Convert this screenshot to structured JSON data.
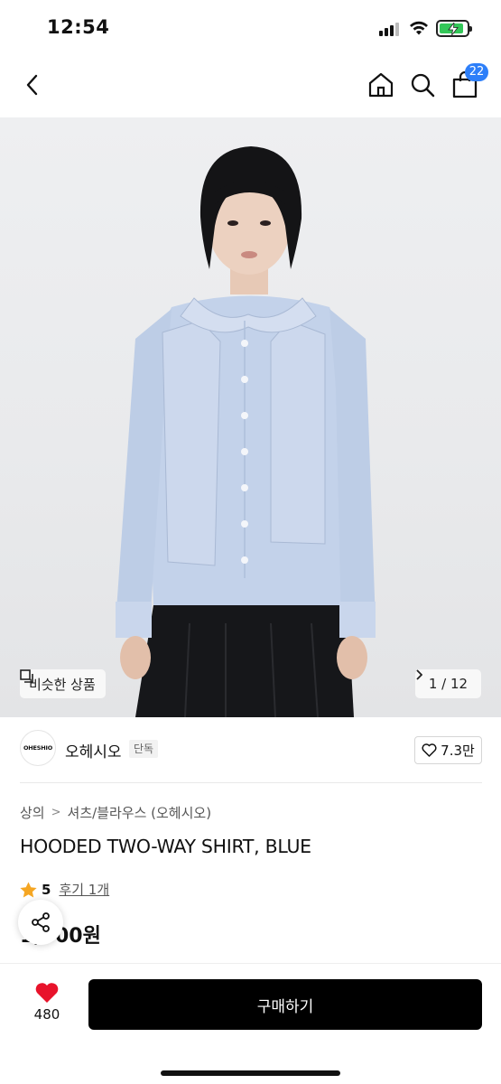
{
  "status_bar": {
    "time": "12:54"
  },
  "nav": {
    "cart_count": "22"
  },
  "hero": {
    "similar_label": "비슷한 상품",
    "page_indicator": "1 / 12"
  },
  "brand": {
    "logo_text": "OHESHIO",
    "name": "오헤시오",
    "tag": "단독",
    "like_count": "7.3만"
  },
  "product": {
    "breadcrumb": [
      "상의",
      "셔츠/블라우스 (오헤시오)"
    ],
    "title": "HOODED TWO-WAY SHIRT, BLUE",
    "rating": "5",
    "review_label": "후기 1개",
    "price": "1,000원"
  },
  "bottom": {
    "wish_count": "480",
    "buy_label": "구매하기"
  },
  "colors": {
    "accent_blue": "#2d7ff9",
    "heart_red": "#e8132b",
    "star_orange": "#f5a623",
    "battery_green": "#34c759"
  },
  "icons": [
    "back-icon",
    "home-icon",
    "search-icon",
    "shopping-bag-icon",
    "similar-items-icon",
    "chevron-right-icon",
    "heart-outline-icon",
    "star-icon",
    "share-icon",
    "heart-filled-icon"
  ]
}
